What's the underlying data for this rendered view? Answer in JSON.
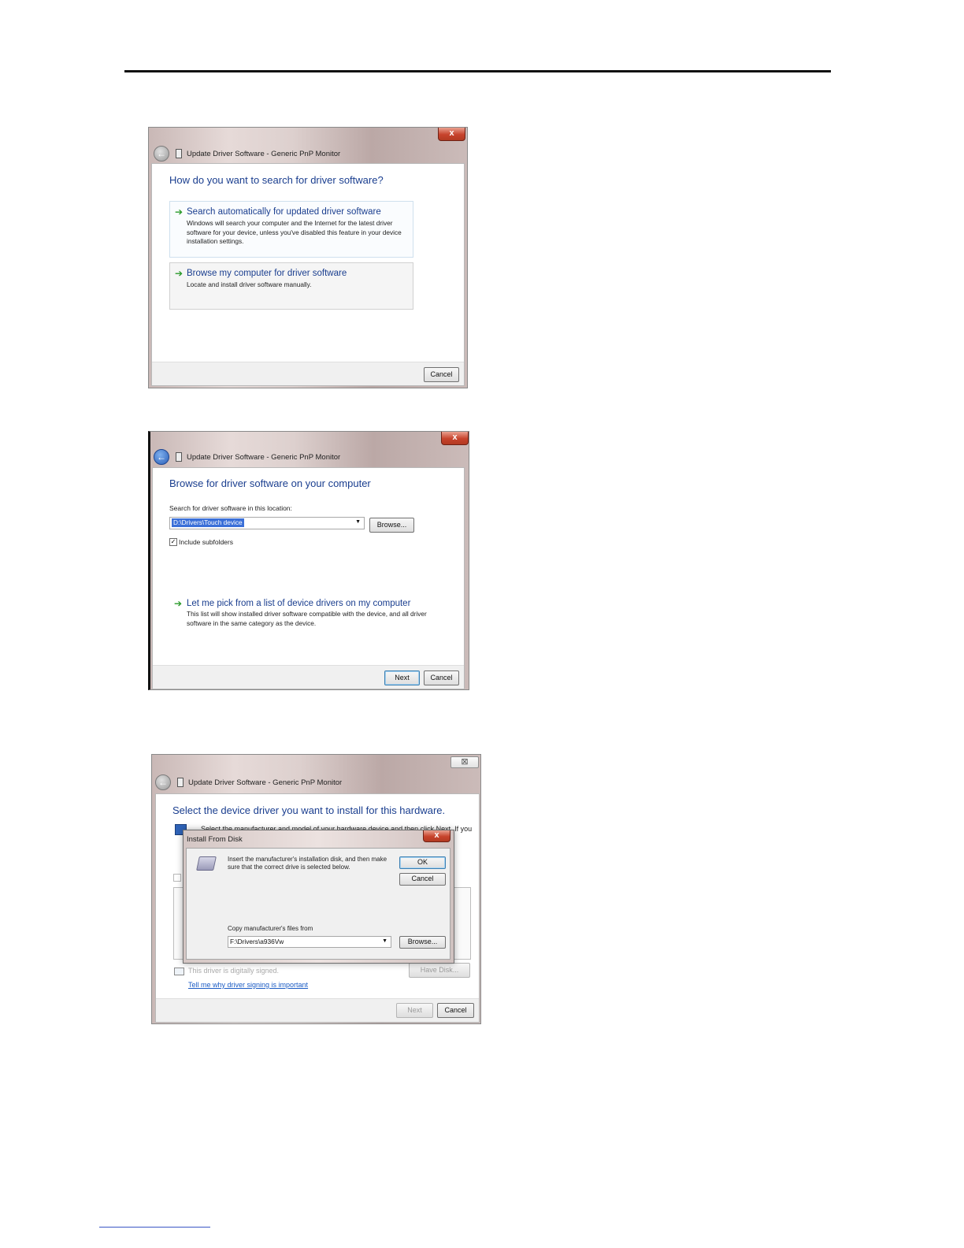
{
  "dialog1": {
    "close": "x",
    "title": "Update Driver Software - Generic PnP Monitor",
    "heading": "How do you want to search for driver software?",
    "options": [
      {
        "title": "Search automatically for updated driver software",
        "description": "Windows will search your computer and the Internet for the latest driver software for your device, unless you've disabled this feature in your device installation settings."
      },
      {
        "title": "Browse my computer for driver software",
        "description": "Locate and install driver software manually."
      }
    ],
    "cancel": "Cancel"
  },
  "dialog2": {
    "close": "x",
    "title": "Update Driver Software - Generic PnP Monitor",
    "heading": "Browse for driver software on your computer",
    "search_label": "Search for driver software in this location:",
    "path_value": "D:\\Drivers\\Touch device",
    "browse": "Browse...",
    "include_subfolders": "Include subfolders",
    "include_checked": "✓",
    "pick_title": "Let me pick from a list of device drivers on my computer",
    "pick_description": "This list will show installed driver software compatible with the device, and all driver software in the same category as the device.",
    "next": "Next",
    "cancel": "Cancel"
  },
  "dialog3": {
    "close": "⊠",
    "title": "Update Driver Software - Generic PnP Monitor",
    "heading": "Select the device driver you want to install for this hardware.",
    "intro_partial": "Select the manufacturer and model of your hardware device and then click Next. If you",
    "signed_text": "This driver is digitally signed.",
    "signing_link": "Tell me why driver signing is important",
    "have_disk": "Have Disk...",
    "next": "Next",
    "cancel": "Cancel",
    "install_from_disk": {
      "title": "Install From Disk",
      "close": "x",
      "message": "Insert the manufacturer's installation disk, and then make sure that the correct drive is selected below.",
      "ok": "OK",
      "cancel": "Cancel",
      "copy_label": "Copy manufacturer's files from",
      "path_value": "F:\\Drivers\\a936Vw",
      "browse": "Browse..."
    }
  }
}
